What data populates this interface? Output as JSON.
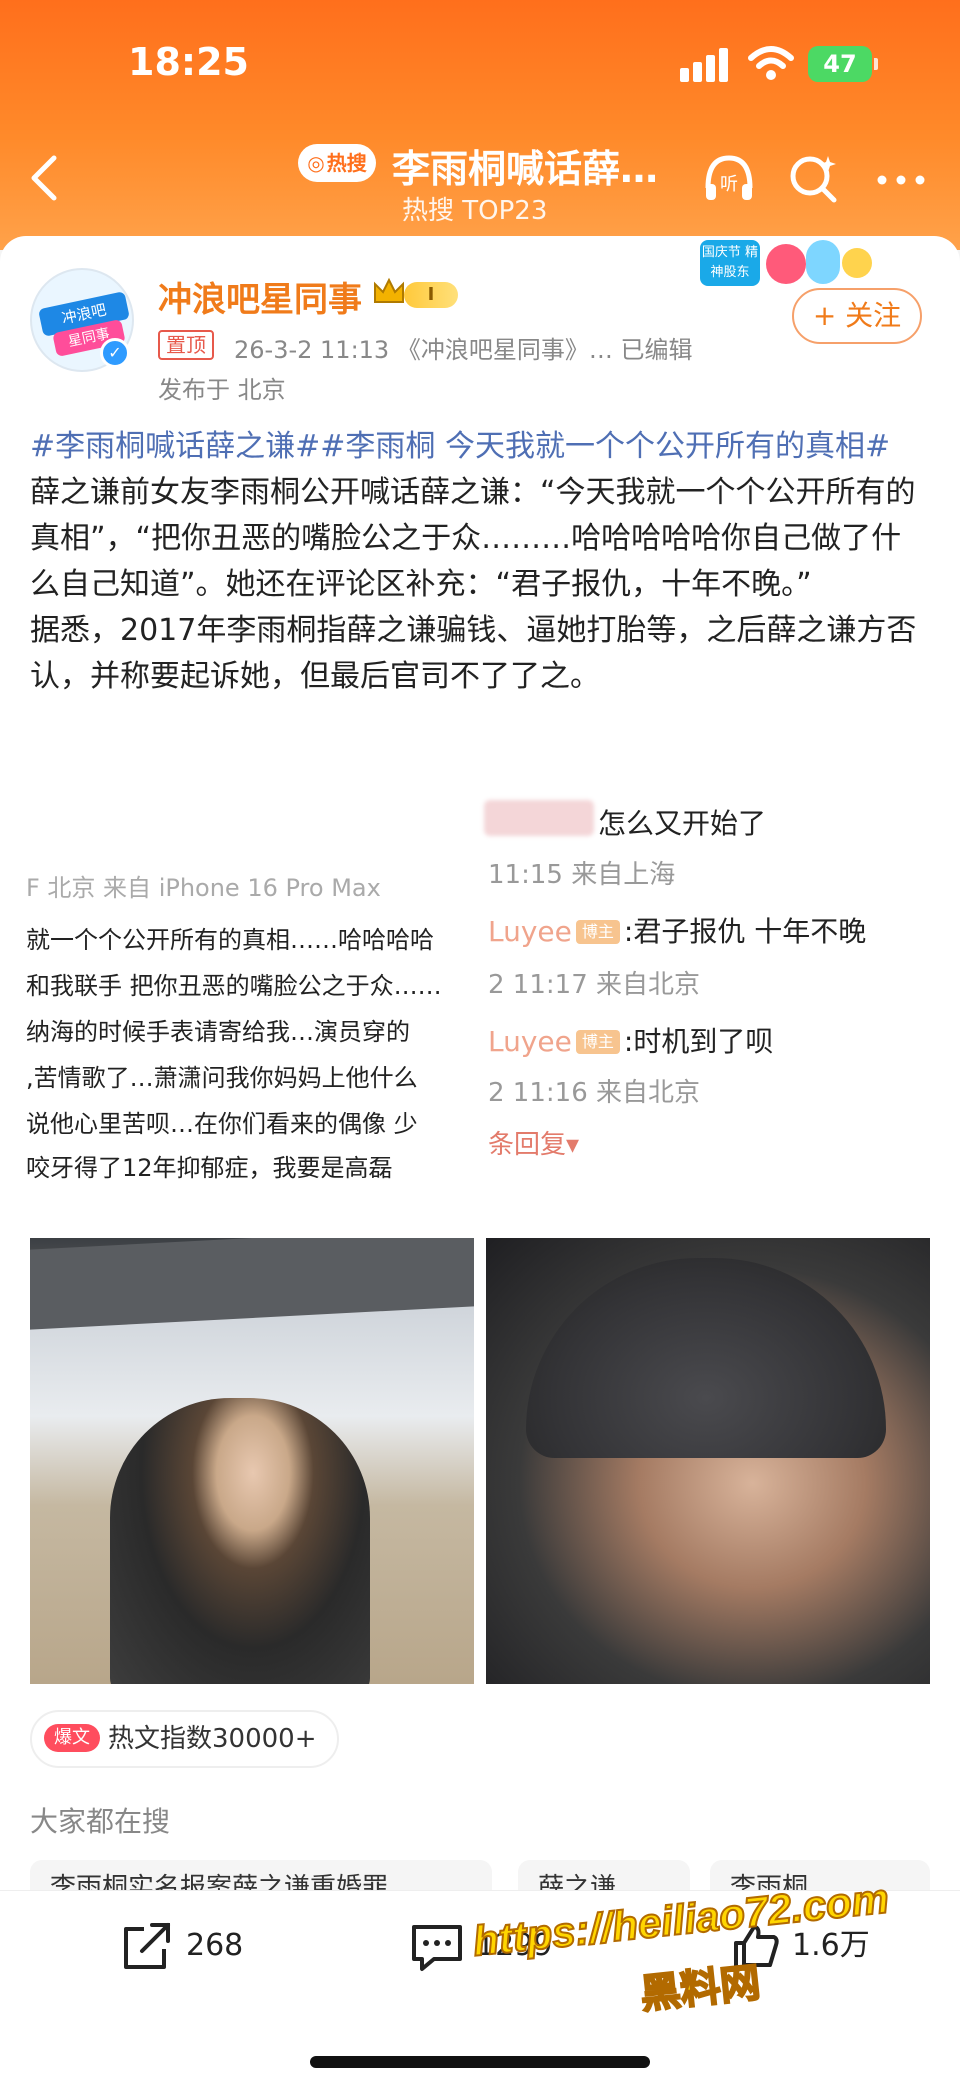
{
  "status_bar": {
    "time": "18:25",
    "battery": "47"
  },
  "header": {
    "hot_badge": "热搜",
    "title": "李雨桐喊话薛…",
    "subtitle": "热搜 TOP23"
  },
  "post": {
    "author": "冲浪吧星同事",
    "level": "I",
    "pinned": "置顶",
    "meta": "26-3-2 11:13  《冲浪吧星同事》…  已编辑",
    "location": "发布于 北京",
    "follow_label": "+ 关注",
    "promo_text": "国庆节 精神股东",
    "avatar_text_1": "冲浪吧",
    "avatar_text_2": "星同事",
    "hashtags": "#李雨桐喊话薛之谦##李雨桐  今天我就一个个公开所有的真相#",
    "body_1": "薛之谦前女友李雨桐公开喊话薛之谦：“今天我就一个个公开所有的真相”，“把你丑恶的嘴脸公之于众………哈哈哈哈哈你自己做了什么自己知道”。她还在评论区补充：“君子报仇，十年不晚。”",
    "body_2": "据悉，2017年李雨桐指薛之谦骗钱、逼她打胎等，之后薛之谦方否认，并称要起诉她，但最后官司不了了之。"
  },
  "screenshot": {
    "left_lines": [
      "F 北京 来自 iPhone 16 Pro Max",
      "就一个个公开所有的真相……哈哈哈哈",
      "和我联手 把你丑恶的嘴脸公之于众……",
      "纳海的时候手表请寄给我…演员穿的",
      ",苦情歌了…萧潇问我你妈妈上他什么",
      "说他心里苦呗…在你们看来的偶像 少",
      "咬牙得了12年抑郁症，我要是高磊"
    ],
    "right_comment_1": "怎么又开始了",
    "right_meta_1": "11:15 来自上海",
    "right_user": "Luyee",
    "host_badge": "博主",
    "right_comment_2": ":君子报仇 十年不晚",
    "right_meta_2": "2 11:17 来自北京",
    "right_comment_3": ":时机到了呗",
    "right_meta_3": "2 11:16 来自北京",
    "more_replies": "条回复▾"
  },
  "hot_index": {
    "badge": "爆文",
    "label": "热文指数30000+"
  },
  "search": {
    "label": "大家都在搜",
    "chips": [
      "李雨桐实名报案薛之谦重婚罪",
      "薛之谦",
      "李雨桐"
    ]
  },
  "actions": {
    "share": "268",
    "comments": "1299",
    "likes": "1.6万"
  },
  "watermark": {
    "url": "https://heiliao72.com",
    "name": "黑料网"
  },
  "colors": {
    "header_orange": "#ff7a22",
    "author_orange": "#f07b1a",
    "hashtag_blue": "#4f6fb4"
  }
}
